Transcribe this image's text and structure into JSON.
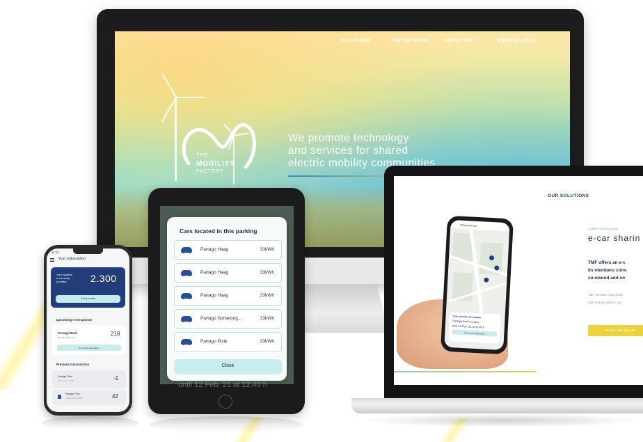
{
  "monitor": {
    "nav": [
      "SOLUTIONS",
      "TMF NETWORK",
      "ABOUT TMF",
      "MEMBER AREA"
    ],
    "logo_line1": "THE",
    "logo_line2": "MOBILITY",
    "logo_line3": "FACTORY",
    "headline_1": "We promote technology",
    "headline_2": "and services for shared",
    "headline_3": "electric mobility communities"
  },
  "laptop": {
    "section_title": "OUR SOLUTIONS",
    "small_label": "COMPLETE SOLUTION",
    "heading": "e-car sharin",
    "bold_1": "TMF offers an e-c",
    "bold_2": "its members cons",
    "bold_3": "co-owned and co",
    "muted_1": "TMF member organisatio",
    "muted_2": "start sharing electric car",
    "button": "KNOW THE SOLUTI",
    "inner_phone": {
      "header": "Choose a car",
      "card_label": "Your current reservation",
      "card_text_1": "Partago Boef is yours",
      "card_text_2": "until 12 Feb. 21 at 12:40 h",
      "card_button": "Go to your reservation"
    }
  },
  "tablet": {
    "modal_title": "Cars located in this parking",
    "cars": [
      {
        "name": "Partago Haag",
        "power": "33kWh"
      },
      {
        "name": "Partago Haag",
        "power": "33kWh"
      },
      {
        "name": "Partago Haag",
        "power": "33kWh"
      },
      {
        "name": "Partago Somelong...",
        "power": "33kWh"
      },
      {
        "name": "Partago Pixie",
        "power": "33kWh"
      }
    ],
    "close_label": "Close",
    "background_text": "until 12 Feb. 21 at 12.40 h"
  },
  "phone": {
    "time": "11:13",
    "header": "Your Subscription",
    "balance_label_1": "Your balance",
    "balance_label_2": "is currently",
    "balance_label_3": "(credits)",
    "balance_value": "2.300",
    "buy_label": "€  Buy credits",
    "upcoming_title": "Upcoming reservation/s",
    "reservation_name": "Partago Boef",
    "reservation_date": "12 Feb 21 at 11:35",
    "reservation_value": "218",
    "goto_label": "Go to your reservation",
    "previous_title": "Previous transactions",
    "transactions": [
      {
        "name": "Partago Pixie",
        "date": "15 Jan 21 at 12:30",
        "value": "-1"
      },
      {
        "name": "Partago Pixie",
        "date": "13 Dec 20 at 14:00",
        "value": "42"
      }
    ]
  },
  "colors": {
    "brand_navy": "#233d7a",
    "accent_teal": "#c6ecec",
    "accent_yellow": "#ecd33b"
  }
}
